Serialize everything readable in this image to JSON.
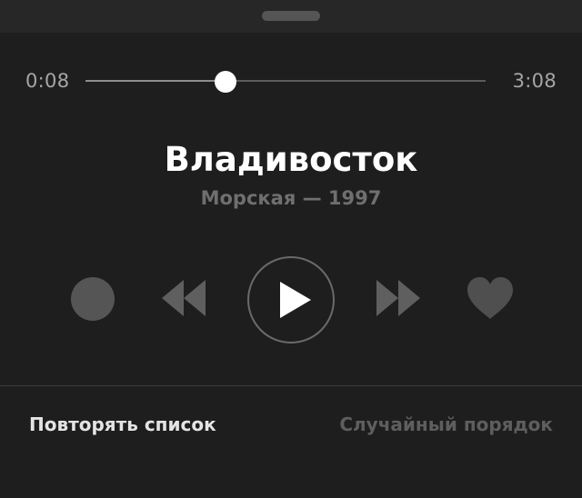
{
  "player": {
    "elapsed_time": "0:08",
    "total_time": "3:08",
    "progress_fraction": 0.35,
    "track": {
      "title": "Владивосток",
      "subtitle": "Морская — 1997"
    },
    "controls": {
      "record": "record-icon",
      "rewind": "rewind-icon",
      "play": "play-icon",
      "forward": "fast-forward-icon",
      "like": "heart-icon"
    }
  },
  "options": {
    "repeat_label": "Повторять список",
    "shuffle_label": "Случайный порядок"
  },
  "colors": {
    "background": "#1e1e1e",
    "top_bar": "#272727",
    "active_text": "#ffffff",
    "muted_text": "#6f6f6f",
    "control_icon": "#5a5a5a"
  }
}
